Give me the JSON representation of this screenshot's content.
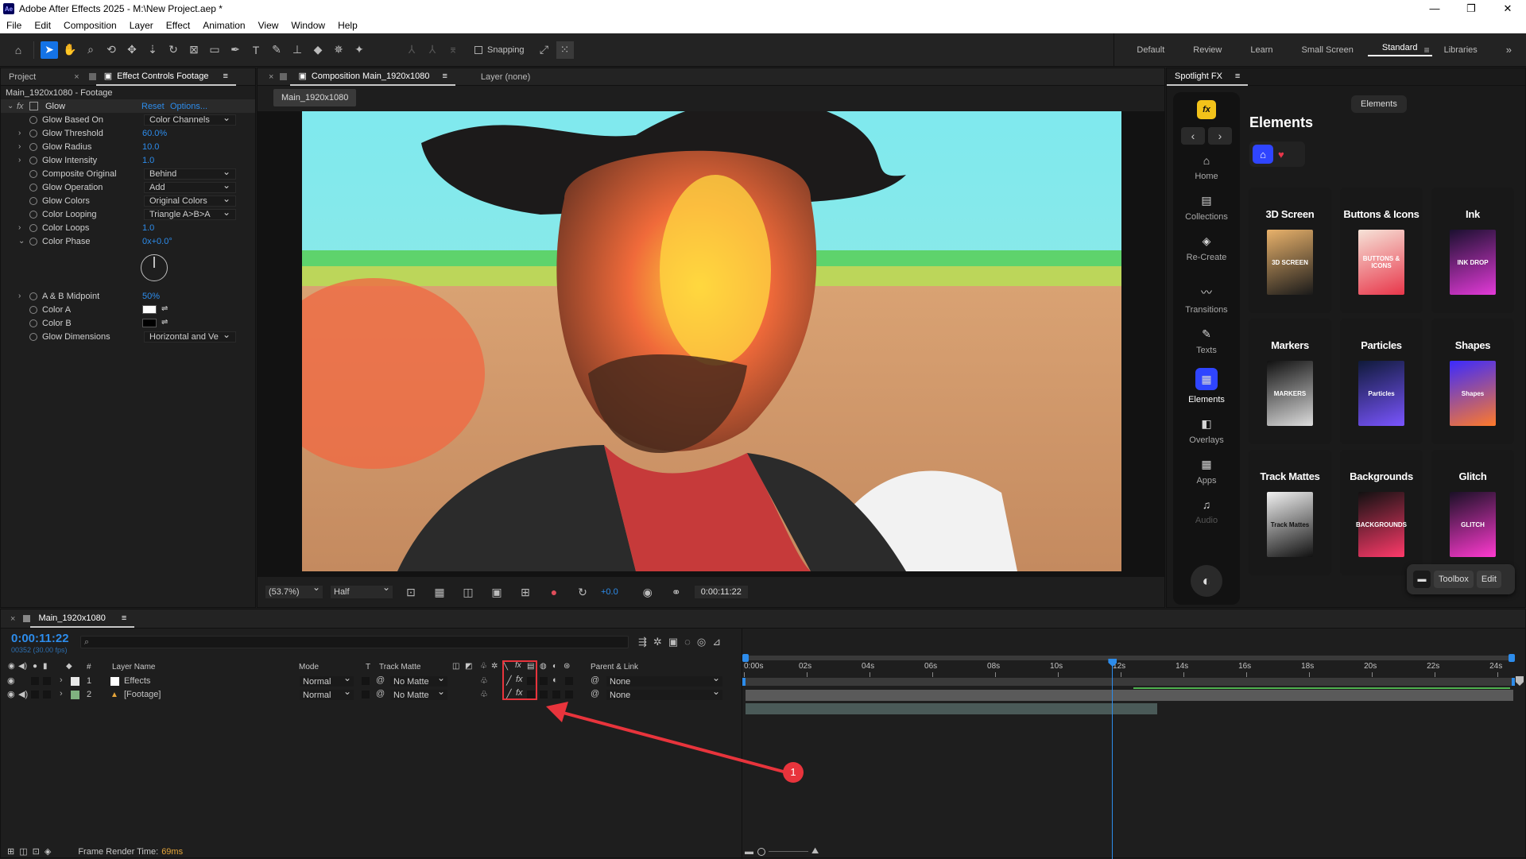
{
  "app": {
    "title": "Adobe After Effects 2025 - M:\\New Project.aep *",
    "logo": "Ae",
    "window_controls": [
      "—",
      "❐",
      "✕"
    ]
  },
  "menu": [
    "File",
    "Edit",
    "Composition",
    "Layer",
    "Effect",
    "Animation",
    "View",
    "Window",
    "Help"
  ],
  "toolbar": {
    "snapping_label": "Snapping",
    "workspaces": [
      "Default",
      "Review",
      "Learn",
      "Small Screen",
      "Standard",
      "Libraries"
    ],
    "active_workspace": "Standard",
    "overflow": "»"
  },
  "left_panel": {
    "tab_project": "Project",
    "tab_effect_controls": "Effect Controls Footage",
    "breadcrumb": "Main_1920x1080 - Footage",
    "effect_name": "Glow",
    "reset_label": "Reset",
    "options_label": "Options...",
    "properties": [
      {
        "name": "Glow Based On",
        "value": "Color Channels",
        "kind": "dropdown"
      },
      {
        "name": "Glow Threshold",
        "value": "60.0%",
        "kind": "value"
      },
      {
        "name": "Glow Radius",
        "value": "10.0",
        "kind": "value"
      },
      {
        "name": "Glow Intensity",
        "value": "1.0",
        "kind": "value"
      },
      {
        "name": "Composite Original",
        "value": "Behind",
        "kind": "dropdown"
      },
      {
        "name": "Glow Operation",
        "value": "Add",
        "kind": "dropdown"
      },
      {
        "name": "Glow Colors",
        "value": "Original Colors",
        "kind": "dropdown"
      },
      {
        "name": "Color Looping",
        "value": "Triangle A>B>A",
        "kind": "dropdown"
      },
      {
        "name": "Color Loops",
        "value": "1.0",
        "kind": "value"
      },
      {
        "name": "Color Phase",
        "value": "0x+0.0°",
        "kind": "value"
      }
    ],
    "properties2": [
      {
        "name": "A & B Midpoint",
        "value": "50%",
        "kind": "value"
      },
      {
        "name": "Color A",
        "value": "",
        "kind": "color"
      },
      {
        "name": "Color B",
        "value": "",
        "kind": "color"
      },
      {
        "name": "Glow Dimensions",
        "value": "Horizontal and Ve",
        "kind": "dropdown"
      }
    ]
  },
  "comp_panel": {
    "tab_label": "Composition Main_1920x1080",
    "layer_tab": "Layer (none)",
    "comp_button": "Main_1920x1080",
    "zoom": "(53.7%)",
    "resolution": "Half",
    "exposure": "+0.0",
    "timecode": "0:00:11:22"
  },
  "spotlight": {
    "panel_title": "Spotlight FX",
    "logo": "fx",
    "nav": [
      "‹",
      "›"
    ],
    "tabs_button": "Elements",
    "heading": "Elements",
    "sidebar": [
      {
        "label": "Home",
        "icon": "⌂"
      },
      {
        "label": "Collections",
        "icon": "▤"
      },
      {
        "label": "Re-Create",
        "icon": "◈"
      },
      {
        "label": "Transitions",
        "icon": "〰"
      },
      {
        "label": "Texts",
        "icon": "✎"
      },
      {
        "label": "Elements",
        "icon": "▦"
      },
      {
        "label": "Overlays",
        "icon": "◧"
      },
      {
        "label": "Apps",
        "icon": "▦"
      },
      {
        "label": "Audio",
        "icon": "♫"
      }
    ],
    "cards": [
      {
        "title": "3D Screen",
        "thumb": "3D SCREEN"
      },
      {
        "title": "Buttons & Icons",
        "thumb": "BUTTONS & ICONS"
      },
      {
        "title": "Ink",
        "thumb": "INK DROP"
      },
      {
        "title": "Markers",
        "thumb": "MARKERS"
      },
      {
        "title": "Particles",
        "thumb": "Particles"
      },
      {
        "title": "Shapes",
        "thumb": "Shapes"
      },
      {
        "title": "Track Mattes",
        "thumb": "Track Mattes"
      },
      {
        "title": "Backgrounds",
        "thumb": "BACKGROUNDS"
      },
      {
        "title": "Glitch",
        "thumb": "GLITCH"
      }
    ],
    "toolbox_label": "Toolbox",
    "edit_label": "Edit"
  },
  "timeline": {
    "tab_label": "Main_1920x1080",
    "timecode": "0:00:11:22",
    "fps": "00352 (30.00 fps)",
    "search_placeholder": "",
    "columns": {
      "num": "#",
      "layer_name": "Layer Name",
      "mode": "Mode",
      "t": "T",
      "track_matte": "Track Matte",
      "parent": "Parent & Link"
    },
    "layers": [
      {
        "num": "1",
        "name": "Effects",
        "mode": "Normal",
        "matte": "No Matte",
        "parent": "None",
        "label_color": "#e8e8e8"
      },
      {
        "num": "2",
        "name": "[Footage]",
        "mode": "Normal",
        "matte": "No Matte",
        "parent": "None",
        "label_color": "#7fb27f"
      }
    ],
    "ruler": [
      "0:00s",
      "02s",
      "04s",
      "06s",
      "08s",
      "10s",
      "12s",
      "14s",
      "16s",
      "18s",
      "20s",
      "22s",
      "24s"
    ],
    "playhead_seconds": 11.73,
    "duration_seconds": 24.3,
    "footage_end_seconds": 13.0,
    "render_time_label": "Frame Render Time:",
    "render_time_value": "69ms"
  },
  "annotation": {
    "marker_number": "1",
    "color": "#e8343c"
  }
}
